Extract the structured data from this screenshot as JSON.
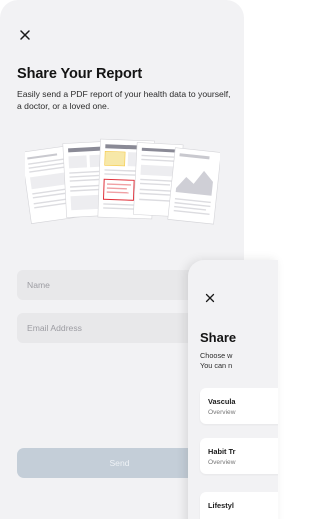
{
  "main": {
    "title": "Share Your Report",
    "subtitle": "Easily send a PDF report of your health data to yourself, a doctor, or a loved one.",
    "name_placeholder": "Name",
    "email_placeholder": "Email Address",
    "send_label": "Send",
    "close_icon": "close-icon",
    "illustration": "report-documents-illustration"
  },
  "sheet": {
    "title": "Share",
    "desc_line1": "Choose w",
    "desc_line2": "You can n",
    "cards": [
      {
        "title": "Vascula",
        "subtitle": "Overview"
      },
      {
        "title": "Habit Tr",
        "subtitle": "Overview"
      },
      {
        "title": "Lifestyl"
      }
    ]
  },
  "colors": {
    "background": "#f2f2f4",
    "field": "#e8e8ea",
    "send_disabled": "#c4ced8",
    "accent_red": "#e0313b",
    "accent_yellow": "#f6c945"
  }
}
